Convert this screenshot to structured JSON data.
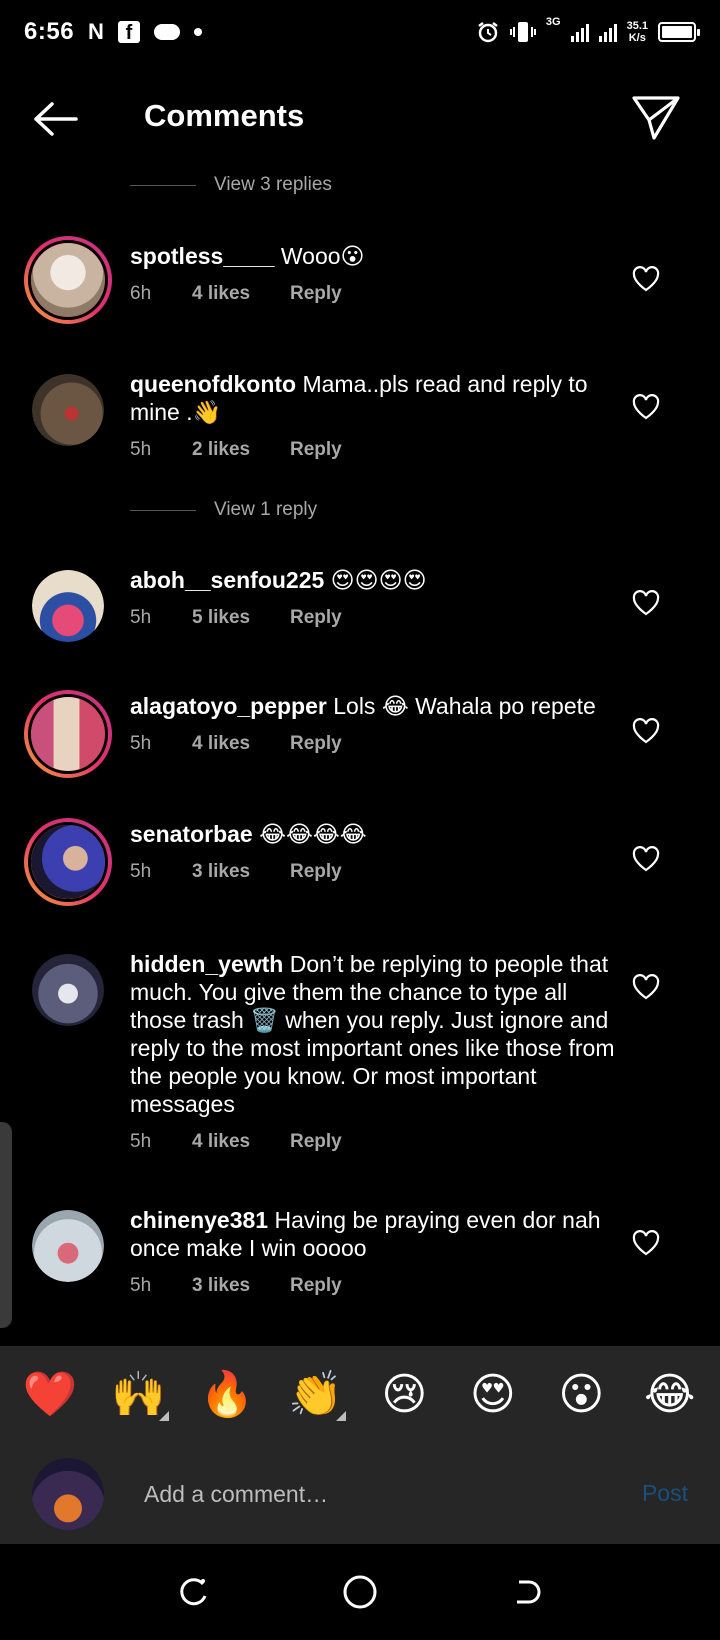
{
  "status_bar": {
    "time": "6:56",
    "network": "3G",
    "speed_value": "35.1",
    "speed_unit": "K/s"
  },
  "header": {
    "title": "Comments"
  },
  "view_replies": [
    {
      "label": "View 3 replies"
    },
    {
      "label": "View 1 reply"
    }
  ],
  "comments": [
    {
      "username": "spotless____",
      "text": " Wooo😮",
      "time": "6h",
      "likes": "4 likes",
      "reply": "Reply"
    },
    {
      "username": "queenofdkonto",
      "text": " Mama..pls read and reply to mine .👋",
      "time": "5h",
      "likes": "2 likes",
      "reply": "Reply"
    },
    {
      "username": "aboh__senfou225",
      "text": " 😍😍😍😍",
      "time": "5h",
      "likes": "5 likes",
      "reply": "Reply"
    },
    {
      "username": "alagatoyo_pepper",
      "text": " Lols 😂 Wahala po repete",
      "time": "5h",
      "likes": "4 likes",
      "reply": "Reply"
    },
    {
      "username": "senatorbae",
      "text": " 😂😂😂😂",
      "time": "5h",
      "likes": "3 likes",
      "reply": "Reply"
    },
    {
      "username": "hidden_yewth",
      "text": " Don’t be replying to people that much. You give them the chance to type all those trash 🗑️ when you reply. Just ignore and reply to the most important ones like those from the people you know. Or most important messages",
      "time": "5h",
      "likes": "4 likes",
      "reply": "Reply"
    },
    {
      "username": "chinenye381",
      "text": " Having be praying even dor nah once make I win ooooo",
      "time": "5h",
      "likes": "3 likes",
      "reply": "Reply"
    }
  ],
  "emoji_bar": [
    "❤️",
    "🙌",
    "🔥",
    "👏",
    "😢",
    "😍",
    "😮",
    "😂"
  ],
  "compose": {
    "placeholder": "Add a comment…",
    "post_label": "Post"
  },
  "colors": {
    "background": "#000000",
    "muted_text": "#a8a8a8",
    "post_button": "#1b4f7e",
    "story_ring_start": "#f7a23b",
    "story_ring_end": "#c13584"
  }
}
